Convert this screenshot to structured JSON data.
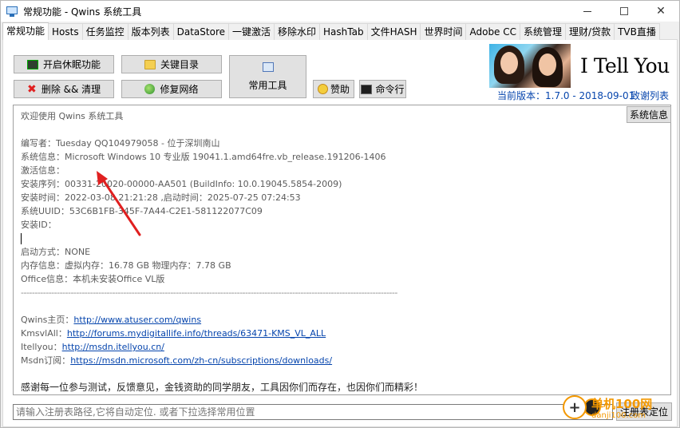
{
  "window": {
    "title": "常规功能 - Qwins 系统工具"
  },
  "tabs": [
    {
      "label": "常规功能"
    },
    {
      "label": "Hosts"
    },
    {
      "label": "任务监控"
    },
    {
      "label": "版本列表"
    },
    {
      "label": "DataStore"
    },
    {
      "label": "一键激活"
    },
    {
      "label": "移除水印"
    },
    {
      "label": "HashTab"
    },
    {
      "label": "文件HASH"
    },
    {
      "label": "世界时间"
    },
    {
      "label": "Adobe CC"
    },
    {
      "label": "系统管理"
    },
    {
      "label": "理财/贷款"
    },
    {
      "label": "TVB直播"
    }
  ],
  "buttons": {
    "sleep": "开启休眠功能",
    "key_dir": "关键目录",
    "delete": "删除 && 清理",
    "repair_net": "修复网络",
    "common_tools": "常用工具",
    "donate": "赞助",
    "cmd": "命令行",
    "sysinfo": "系统信息",
    "locate": "注册表定位"
  },
  "banner": {
    "text": "I Tell You",
    "version": "当前版本：1.7.0 - 2018-09-01",
    "thanks": "致谢列表"
  },
  "info": {
    "welcome": "欢迎使用 Qwins 系统工具",
    "author": "编写者：Tuesday QQ104979058 - 位于深圳南山",
    "sys": "系统信息：Microsoft Windows 10 专业版 19041.1.amd64fre.vb_release.191206-1406",
    "activation": "激活信息：",
    "serial": "安装序列：00331-20020-00000-AA501 (BuildInfo: 10.0.19045.5854-2009)",
    "install_time": "安装时间：2022-03-08 21:21:28 ,启动时间：2025-07-25 07:24:53",
    "uuid": "系统UUID：53C6B1FB-345F-7A44-C2E1-581122077C09",
    "install_id": "安装ID：",
    "boot": "启动方式：NONE",
    "memory": "内存信息：虚拟内存：16.78 GB 物理内存：7.78 GB",
    "office": "Office信息：本机未安装Office VL版",
    "separator": "----------------------------------------------------------------------------------------------------------------------------------------",
    "links": [
      {
        "label": "Qwins主页：",
        "url": "http://www.atuser.com/qwins"
      },
      {
        "label": "KmsvlAll：",
        "url": "http://forums.mydigitallife.info/threads/63471-KMS_VL_ALL"
      },
      {
        "label": "Itellyou：",
        "url": "http://msdn.itellyou.cn/"
      },
      {
        "label": "Msdn订阅：",
        "url": "https://msdn.microsoft.com/zh-cn/subscriptions/downloads/"
      }
    ],
    "thanks_msg": "感谢每一位参与测试，反馈意见，金钱资助的同学朋友，工具因你们而存在，也因你们而精彩！"
  },
  "registry": {
    "placeholder": "请输入注册表路径,它将自动定位. 或者下拉选择常用位置"
  },
  "watermark": {
    "site": "单机100网",
    "domain": "danji100.com"
  },
  "colors": {
    "link": "#0645ad",
    "arrow": "#e02020"
  }
}
